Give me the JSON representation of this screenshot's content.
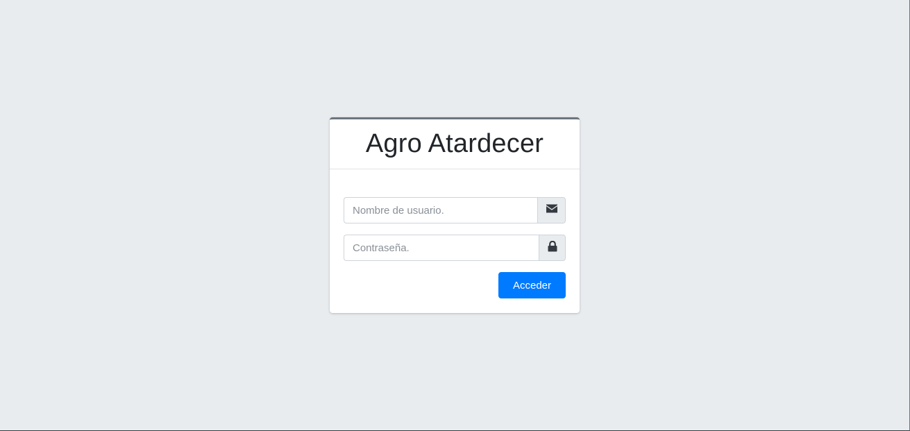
{
  "brand": {
    "title": "Agro Atardecer"
  },
  "form": {
    "username": {
      "value": "",
      "placeholder": "Nombre de usuario.",
      "icon": "envelope-icon"
    },
    "password": {
      "value": "",
      "placeholder": "Contraseña.",
      "icon": "lock-icon"
    },
    "submit_label": "Acceder"
  },
  "colors": {
    "background": "#e9ecef",
    "card_top_border": "#6c757d",
    "primary": "#007bff",
    "icon": "#343a40"
  }
}
